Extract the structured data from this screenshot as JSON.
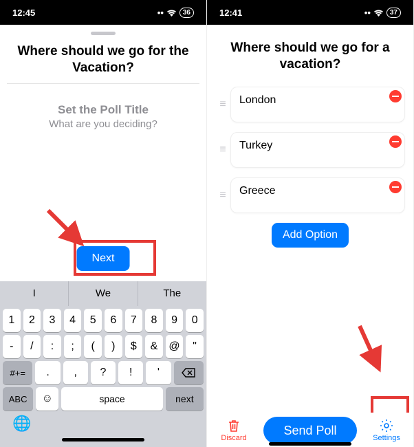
{
  "left": {
    "status": {
      "time": "12:45",
      "battery": "36"
    },
    "title": "Where should we go for the Vacation?",
    "subtitle_heading": "Set the Poll Title",
    "subtitle_prompt": "What are you deciding?",
    "next_label": "Next",
    "suggestions": [
      "I",
      "We",
      "The"
    ],
    "row1": [
      "1",
      "2",
      "3",
      "4",
      "5",
      "6",
      "7",
      "8",
      "9",
      "0"
    ],
    "row2": [
      "-",
      "/",
      ":",
      ";",
      "(",
      ")",
      "$",
      "&",
      "@",
      "\""
    ],
    "row3_mod": "#+=",
    "row3": [
      ".",
      ",",
      "?",
      "!",
      "'"
    ],
    "abc": "ABC",
    "space": "space",
    "next_key": "next"
  },
  "right": {
    "status": {
      "time": "12:41",
      "battery": "37"
    },
    "title": "Where should we go for a vacation?",
    "options": [
      "London",
      "Turkey",
      "Greece"
    ],
    "add_option": "Add Option",
    "discard": "Discard",
    "send": "Send Poll",
    "settings": "Settings"
  }
}
